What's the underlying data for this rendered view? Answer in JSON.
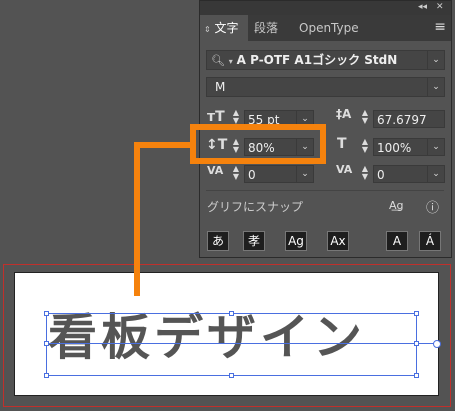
{
  "panel": {
    "topbar": {
      "collapse": "◂◂",
      "close": "✕"
    },
    "tabs": [
      {
        "label": "文字",
        "active": true
      },
      {
        "label": "段落",
        "active": false
      },
      {
        "label": "OpenType",
        "active": false
      }
    ],
    "font_family": "A P-OTF A1ゴシック StdN",
    "font_style": "M",
    "font_size": "55 pt",
    "leading": "67.6797",
    "vertical_scale": "80%",
    "horizontal_scale": "100%",
    "kerning": "0",
    "tracking": "0",
    "glyph_snap_label": "グリフにスナップ",
    "glyph_buttons": [
      "あ",
      "孝",
      "Ag",
      "Ax",
      "A",
      "Á"
    ]
  },
  "artboard": {
    "text": "看板デザイン"
  },
  "colors": {
    "accent_orange": "#f5820d",
    "selection_blue": "#4a6fe0",
    "artboard_border": "#c0302c"
  }
}
